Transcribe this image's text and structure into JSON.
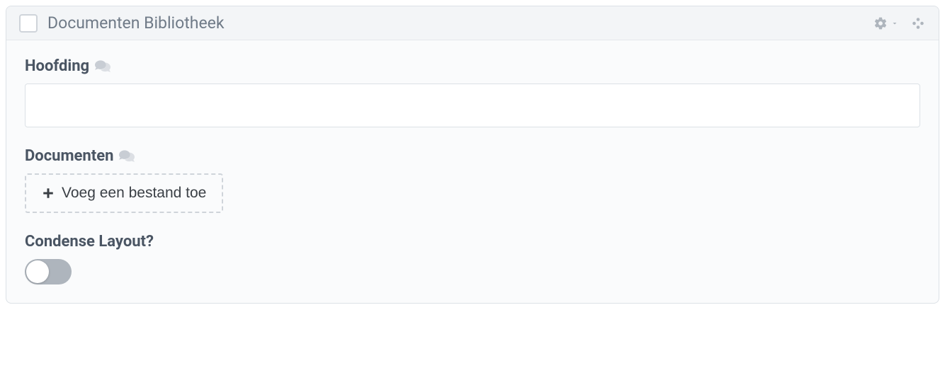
{
  "panel": {
    "title": "Documenten Bibliotheek"
  },
  "fields": {
    "heading": {
      "label": "Hoofding",
      "value": ""
    },
    "documents": {
      "label": "Documenten",
      "add_file_label": "Voeg een bestand toe"
    },
    "condense": {
      "label": "Condense Layout?",
      "enabled": false
    }
  }
}
